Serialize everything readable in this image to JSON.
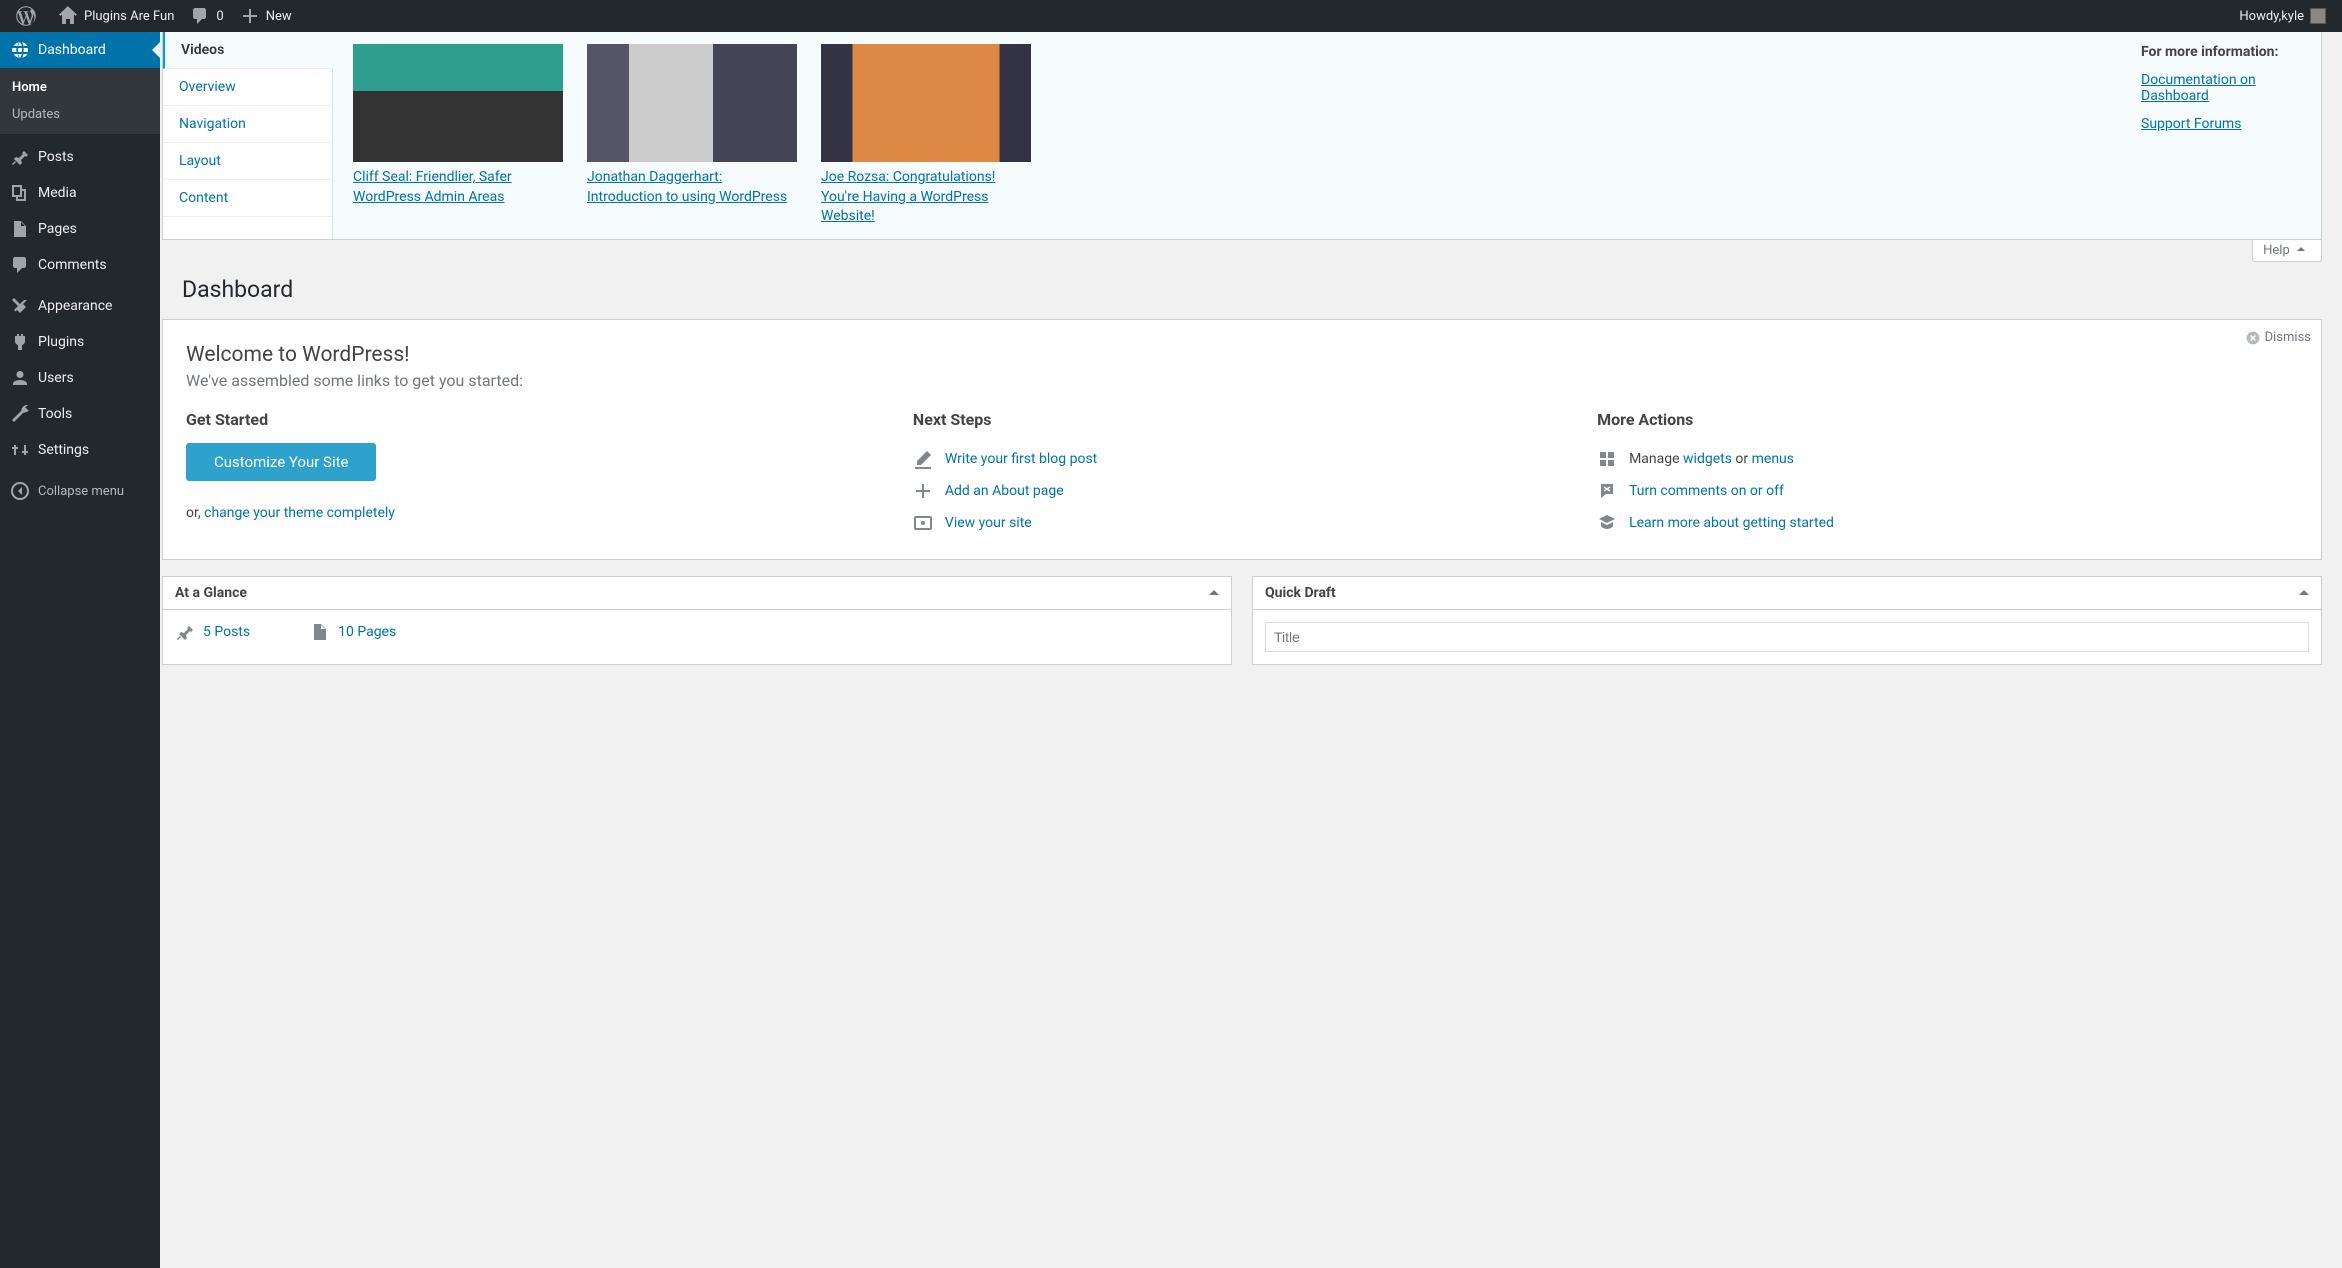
{
  "adminbar": {
    "site_name": "Plugins Are Fun",
    "comments_count": "0",
    "new_label": "New",
    "howdy_prefix": "Howdy, ",
    "username": "kyle"
  },
  "adminmenu": {
    "dashboard": "Dashboard",
    "submenu": {
      "home": "Home",
      "updates": "Updates"
    },
    "posts": "Posts",
    "media": "Media",
    "pages": "Pages",
    "comments": "Comments",
    "appearance": "Appearance",
    "plugins": "Plugins",
    "users": "Users",
    "tools": "Tools",
    "settings": "Settings",
    "collapse": "Collapse menu"
  },
  "help": {
    "tabs": {
      "videos": "Videos",
      "overview": "Overview",
      "navigation": "Navigation",
      "layout": "Layout",
      "content": "Content"
    },
    "videos": {
      "v1": "Cliff Seal: Friendlier, Safer WordPress Admin Areas",
      "v2": "Jonathan Daggerhart: Introduction to using WordPress",
      "v3": "Joe Rozsa: Congratulations! You're Having a WordPress Website!"
    },
    "sidebar": {
      "heading": "For more information:",
      "doc": "Documentation on Dashboard",
      "forums": "Support Forums"
    }
  },
  "screen_meta": {
    "help": "Help"
  },
  "page_title": "Dashboard",
  "welcome": {
    "title": "Welcome to WordPress!",
    "about": "We've assembled some links to get you started:",
    "dismiss": "Dismiss",
    "col1": {
      "heading": "Get Started",
      "button": "Customize Your Site",
      "or_prefix": "or, ",
      "change_theme": "change your theme completely"
    },
    "col2": {
      "heading": "Next Steps",
      "write_post": "Write your first blog post",
      "add_about": "Add an About page",
      "view_site": "View your site"
    },
    "col3": {
      "heading": "More Actions",
      "manage_prefix": "Manage ",
      "widgets": "widgets",
      "or": " or ",
      "menus": "menus",
      "comments_toggle": "Turn comments on or off",
      "learn_more": "Learn more about getting started"
    }
  },
  "glance": {
    "heading": "At a Glance",
    "posts": "5 Posts",
    "pages": "10 Pages"
  },
  "draft": {
    "heading": "Quick Draft",
    "title_placeholder": "Title"
  }
}
